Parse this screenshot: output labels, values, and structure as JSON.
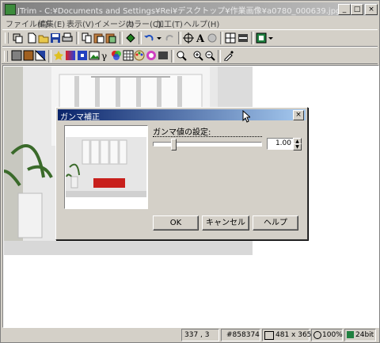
{
  "window": {
    "title": "JTrim - C:¥Documents and Settings¥Rei¥デスクトップ¥作業画像¥a0780_000639.jpg",
    "minimize": "_",
    "maximize": "□",
    "close": "×"
  },
  "menu": [
    {
      "label": "ファイル(F)"
    },
    {
      "label": "編集(E)"
    },
    {
      "label": "表示(V)"
    },
    {
      "label": "イメージ(I)"
    },
    {
      "label": "カラー(C)"
    },
    {
      "label": "加工(T)"
    },
    {
      "label": "ヘルプ(H)"
    }
  ],
  "dialog": {
    "title": "ガンマ補正",
    "close": "×",
    "setting_label": "ガンマ値の設定:",
    "gamma_value": "1.00",
    "gamma_slider_fraction": 0.18,
    "ok": "OK",
    "cancel": "キャンセル",
    "help": "ヘルプ"
  },
  "status": {
    "coords": "337 , 3",
    "color": "#858374",
    "size": "481 x 365",
    "zoom": "100%",
    "depth": "24bit"
  },
  "colors": {
    "title_active": "#0a246a",
    "sofa": "#c8201c"
  }
}
